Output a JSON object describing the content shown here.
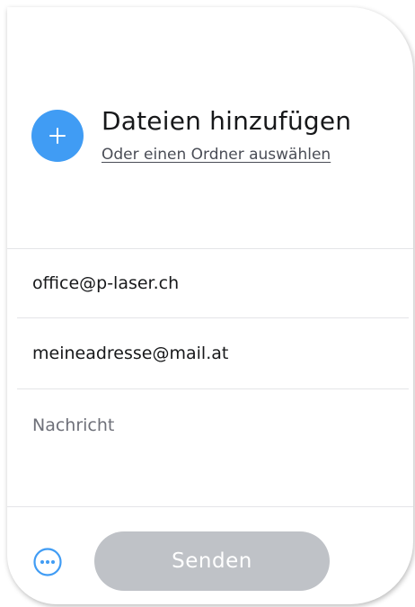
{
  "upload": {
    "title": "Dateien hinzufügen",
    "folder_link": "Oder einen Ordner auswählen"
  },
  "form": {
    "recipient_value": "office@p-laser.ch",
    "sender_value": "meineadresse@mail.at",
    "message_placeholder": "Nachricht"
  },
  "footer": {
    "more_icon": "more-options-icon",
    "send_label": "Senden"
  },
  "colors": {
    "accent": "#409cf4",
    "send_disabled": "#bfc2c7",
    "text": "#17181a",
    "placeholder": "#6e7079"
  }
}
